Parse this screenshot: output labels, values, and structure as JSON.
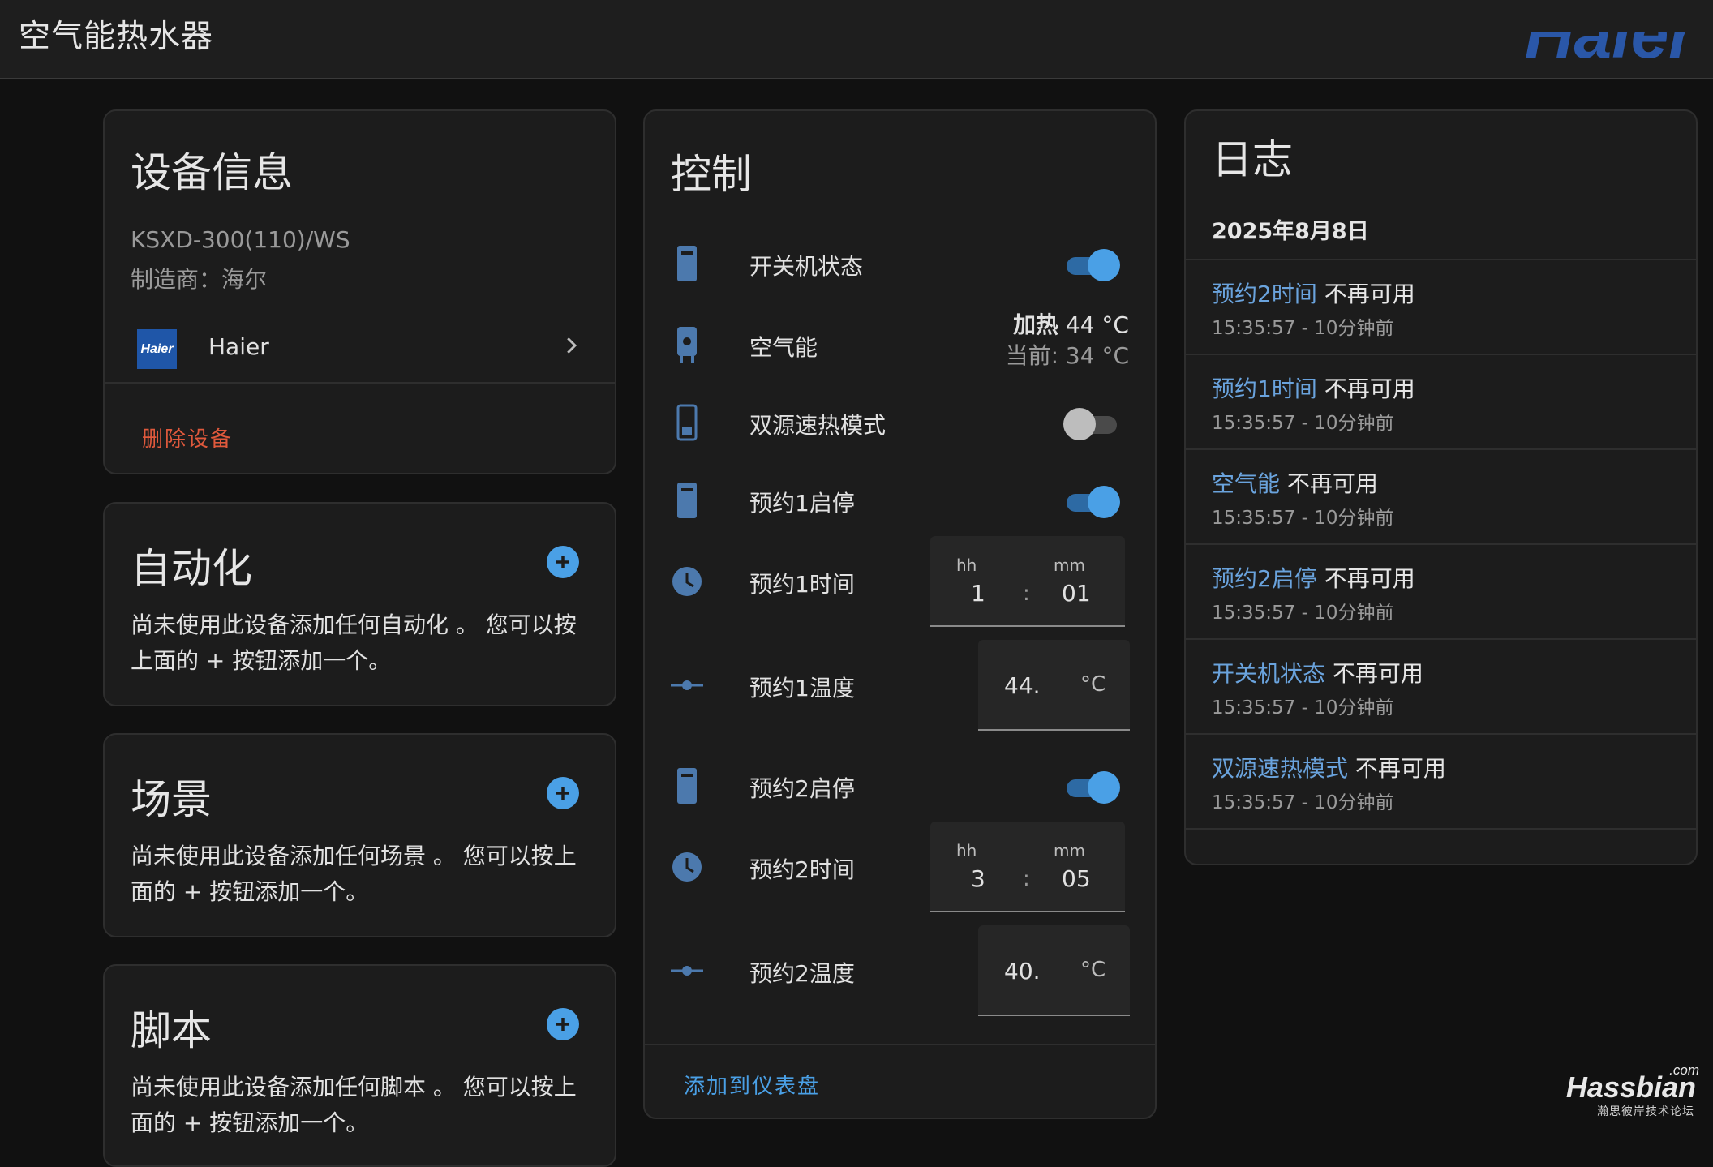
{
  "app": {
    "title": "空气能热水器",
    "brand_corner": "Haier"
  },
  "device_info": {
    "title": "设备信息",
    "model": "KSXD-300(110)/WS",
    "manufacturer": "制造商：海尔",
    "brand_logo_text": "Haier",
    "brand_name": "Haier",
    "delete_label": "删除设备"
  },
  "automation": {
    "title": "自动化",
    "desc": "尚未使用此设备添加任何自动化 。 您可以按上面的 + 按钮添加一个。"
  },
  "scene": {
    "title": "场景",
    "desc": "尚未使用此设备添加任何场景 。 您可以按上面的 + 按钮添加一个。"
  },
  "script": {
    "title": "脚本",
    "desc": "尚未使用此设备添加任何脚本 。 您可以按上面的 + 按钮添加一个。"
  },
  "control": {
    "title": "控制",
    "rows": [
      {
        "label": "开关机状态",
        "icon": "water-heater-icon",
        "toggle": true
      },
      {
        "label": "空气能",
        "icon": "water-boiler-icon",
        "state_mode": "加热",
        "state_target": "44 °C",
        "state_current": "当前: 34 °C"
      },
      {
        "label": "双源速热模式",
        "icon": "water-heater-off-icon",
        "toggle": false
      },
      {
        "label": "预约1启停",
        "icon": "water-heater-icon",
        "toggle": true
      },
      {
        "label": "预约1时间",
        "icon": "clock-icon",
        "hh_label": "hh",
        "mm_label": "mm",
        "hh": "1",
        "sep": ":",
        "mm": "01"
      },
      {
        "label": "预约1温度",
        "icon": "slider-icon",
        "value": "44.",
        "unit": "°C"
      },
      {
        "label": "预约2启停",
        "icon": "water-heater-icon",
        "toggle": true
      },
      {
        "label": "预约2时间",
        "icon": "clock-icon",
        "hh_label": "hh",
        "mm_label": "mm",
        "hh": "3",
        "sep": ":",
        "mm": "05"
      },
      {
        "label": "预约2温度",
        "icon": "slider-icon",
        "value": "40.",
        "unit": "°C"
      }
    ],
    "add_to_dashboard": "添加到仪表盘"
  },
  "log": {
    "title": "日志",
    "date": "2025年8月8日",
    "items": [
      {
        "entity": "预约2时间",
        "message": "不再可用",
        "time": "15:35:57 - 10分钟前"
      },
      {
        "entity": "预约1时间",
        "message": "不再可用",
        "time": "15:35:57 - 10分钟前"
      },
      {
        "entity": "空气能",
        "message": "不再可用",
        "time": "15:35:57 - 10分钟前"
      },
      {
        "entity": "预约2启停",
        "message": "不再可用",
        "time": "15:35:57 - 10分钟前"
      },
      {
        "entity": "开关机状态",
        "message": "不再可用",
        "time": "15:35:57 - 10分钟前"
      },
      {
        "entity": "双源速热模式",
        "message": "不再可用",
        "time": "15:35:57 - 10分钟前"
      }
    ]
  },
  "watermark": {
    "com": ".com",
    "main": "Hassbian",
    "sub": "瀚思彼岸技术论坛"
  },
  "colors": {
    "accent": "#4aa0e6",
    "danger": "#e0593c",
    "log_entity": "#6aa3dd",
    "background": "#111111",
    "card": "#1c1c1c"
  }
}
